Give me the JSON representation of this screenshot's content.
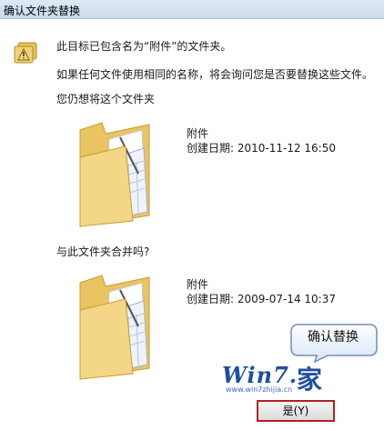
{
  "window": {
    "title": "确认文件夹替换"
  },
  "message": {
    "main": "此目标已包含名为“附件”的文件夹。",
    "sub": "如果任何文件使用相同的名称，将会询问您是否要替换这些文件。",
    "keep_prompt": "您仍想将这个文件夹",
    "merge_prompt": "与此文件夹合并吗?"
  },
  "folders": [
    {
      "name": "附件",
      "created": "创建日期: 2010-11-12 16:50"
    },
    {
      "name": "附件",
      "created": "创建日期: 2009-07-14 10:37"
    }
  ],
  "callout": {
    "text": "确认替换"
  },
  "buttons": {
    "yes_label": "是(Y)"
  },
  "watermark": {
    "brand": "Win7.",
    "char": "家",
    "url": "www.win7zhijia.cn"
  },
  "colors": {
    "accent": "#b02020",
    "titlebar": "#c9d9ec",
    "folder": "#f3d786",
    "logo": "#1f4fa0"
  },
  "icons": [
    "warning-icon",
    "folder-icon",
    "folder-icon"
  ]
}
